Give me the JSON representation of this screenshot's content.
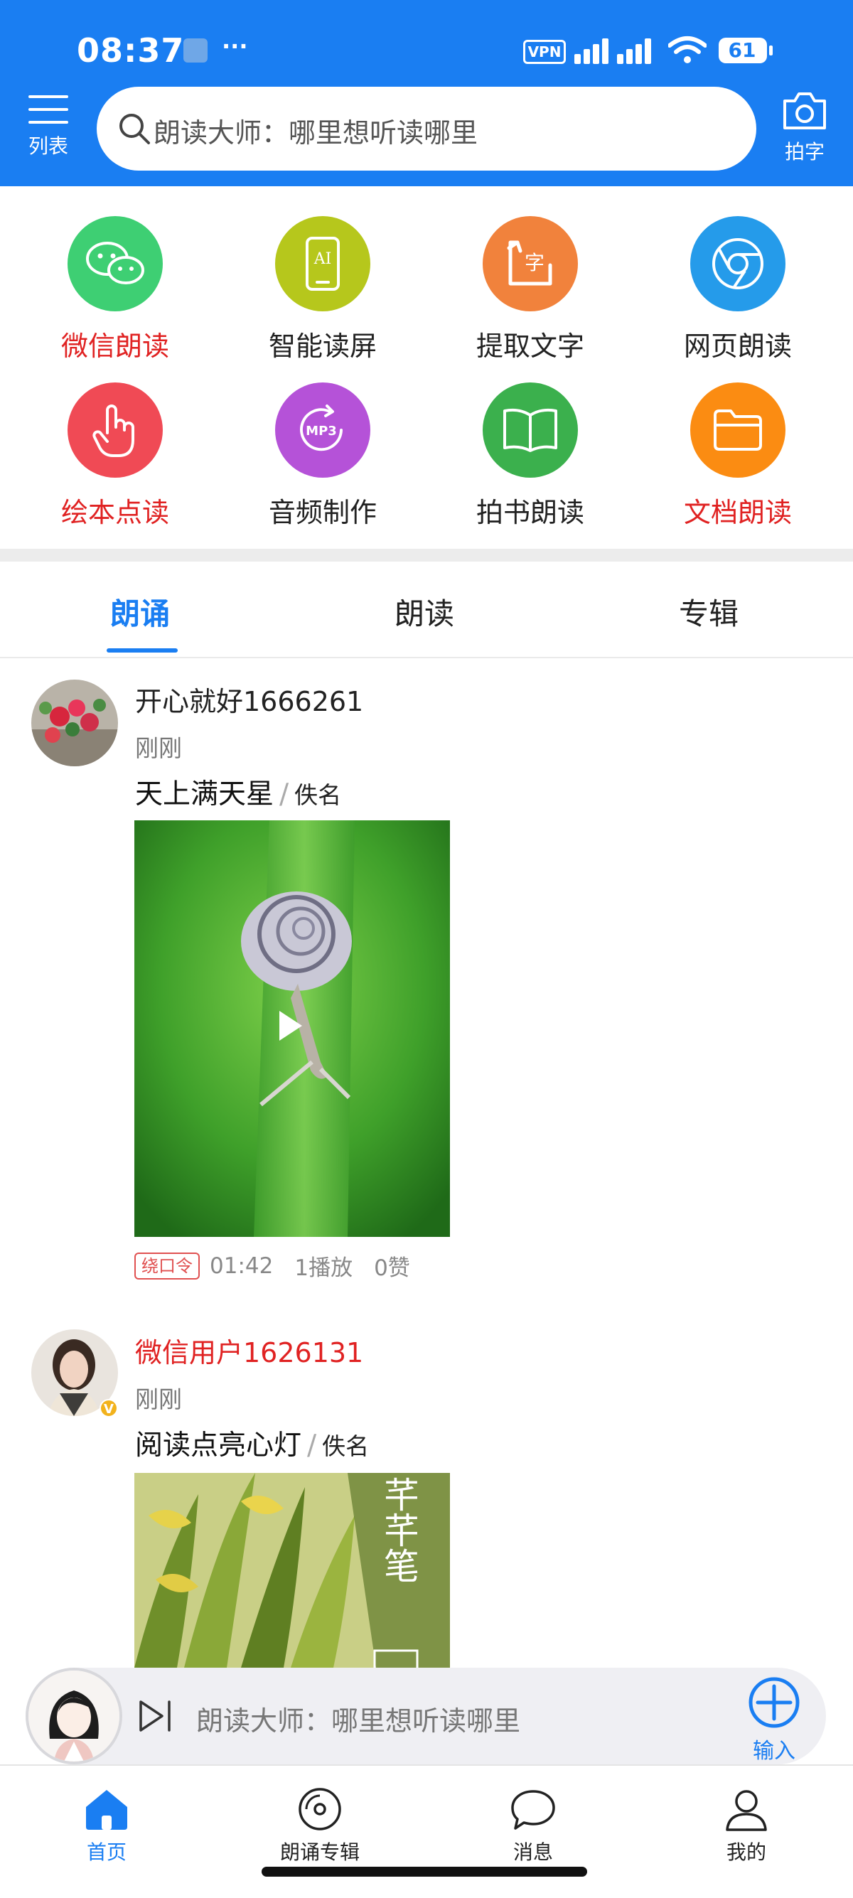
{
  "status_bar": {
    "time": "08:37",
    "dots": "···",
    "vpn": "VPN",
    "battery": "61"
  },
  "header": {
    "menu_label": "列表",
    "search_placeholder": "朗读大师：哪里想听读哪里",
    "camera_label": "拍字"
  },
  "features": [
    {
      "label": "微信朗读",
      "icon": "wechat-icon",
      "color": "#3ecf73",
      "label_color": "red"
    },
    {
      "label": "智能读屏",
      "icon": "ai-phone-icon",
      "color": "#b6c71c",
      "label_color": "dark"
    },
    {
      "label": "提取文字",
      "icon": "extract-text-icon",
      "color": "#f1823c",
      "label_color": "dark"
    },
    {
      "label": "网页朗读",
      "icon": "browser-icon",
      "color": "#259bea",
      "label_color": "dark"
    },
    {
      "label": "绘本点读",
      "icon": "finger-tap-icon",
      "color": "#f04a55",
      "label_color": "red"
    },
    {
      "label": "音频制作",
      "icon": "mp3-icon",
      "color": "#b552d8",
      "label_color": "dark"
    },
    {
      "label": "拍书朗读",
      "icon": "book-icon",
      "color": "#3bb04d",
      "label_color": "dark"
    },
    {
      "label": "文档朗读",
      "icon": "folder-icon",
      "color": "#fb8c12",
      "label_color": "red"
    }
  ],
  "tabs": [
    "朗诵",
    "朗读",
    "专辑"
  ],
  "posts": [
    {
      "username": "开心就好1666261",
      "time": "刚刚",
      "title": "天上满天星",
      "author": "佚名",
      "tag": "绕口令",
      "duration": "01:42",
      "plays": "1播放",
      "likes": "0赞"
    },
    {
      "username": "微信用户1626131",
      "time": "刚刚",
      "title": "阅读点亮心灯",
      "author": "佚名",
      "cover_text": "芊芊笔",
      "badge": "V"
    }
  ],
  "player": {
    "placeholder": "朗读大师：哪里想听读哪里",
    "input_label": "输入"
  },
  "tabbar": [
    {
      "label": "首页",
      "icon": "home-icon"
    },
    {
      "label": "朗诵专辑",
      "icon": "disc-icon"
    },
    {
      "label": "消息",
      "icon": "chat-bubble-icon"
    },
    {
      "label": "我的",
      "icon": "person-icon"
    }
  ],
  "colors": {
    "brand": "#1a7ef2",
    "accent_red": "#e02222"
  }
}
